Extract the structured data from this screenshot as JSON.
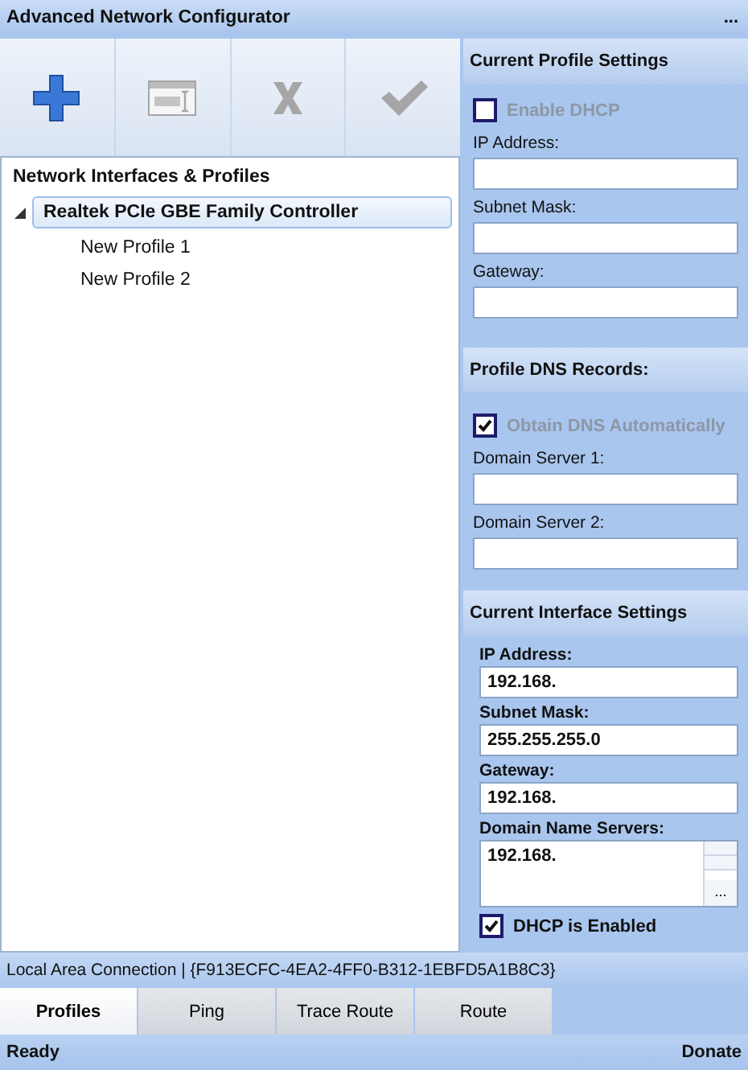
{
  "window": {
    "title": "Advanced Network Configurator",
    "menu_label": "..."
  },
  "toolbar": [
    {
      "kind": "add",
      "disabled": false
    },
    {
      "kind": "rename",
      "disabled": true
    },
    {
      "kind": "delete",
      "disabled": true
    },
    {
      "kind": "apply",
      "disabled": true
    }
  ],
  "tree": {
    "title": "Network Interfaces & Profiles",
    "items": [
      {
        "label": "Realtek PCIe GBE Family Controller",
        "expanded": true,
        "selected": true,
        "children": [
          {
            "label": "New Profile 1",
            "selected": false
          },
          {
            "label": "New Profile 2",
            "selected": false
          }
        ]
      }
    ]
  },
  "profile_settings": {
    "title": "Current Profile Settings",
    "enable_dhcp": {
      "label": "Enable DHCP",
      "checked": false,
      "disabled": true
    },
    "fields": [
      {
        "label": "IP Address:"
      },
      {
        "label": "Subnet Mask:"
      },
      {
        "label": "Gateway:"
      }
    ]
  },
  "profile_dns": {
    "title": "Profile DNS Records:",
    "obtain_dns": {
      "label": "Obtain DNS Automatically",
      "checked": true,
      "disabled": true
    },
    "fields": [
      {
        "label": "Domain Server 1:"
      },
      {
        "label": "Domain Server 2:"
      }
    ]
  },
  "interface_settings": {
    "title": "Current Interface Settings",
    "fields": [
      {
        "label": "IP Address:",
        "value": "192.168."
      },
      {
        "label": "Subnet Mask:",
        "value": "255.255.255.0"
      },
      {
        "label": "Gateway:",
        "value": "192.168."
      }
    ],
    "dns": {
      "label": "Domain Name Servers:",
      "value": "192.168.",
      "button": "..."
    },
    "dhcp": {
      "label": "DHCP is Enabled",
      "checked": true,
      "disabled": false
    }
  },
  "connection": "Local Area Connection | {F913ECFC-4EA2-4FF0-B312-1EBFD5A1B8C3}",
  "tabs": [
    {
      "label": "Profiles",
      "selected": true
    },
    {
      "label": "Ping",
      "selected": false
    },
    {
      "label": "Trace Route",
      "selected": false
    },
    {
      "label": "Route",
      "selected": false
    }
  ],
  "status_bar": {
    "left": "Ready",
    "right": "Donate"
  }
}
